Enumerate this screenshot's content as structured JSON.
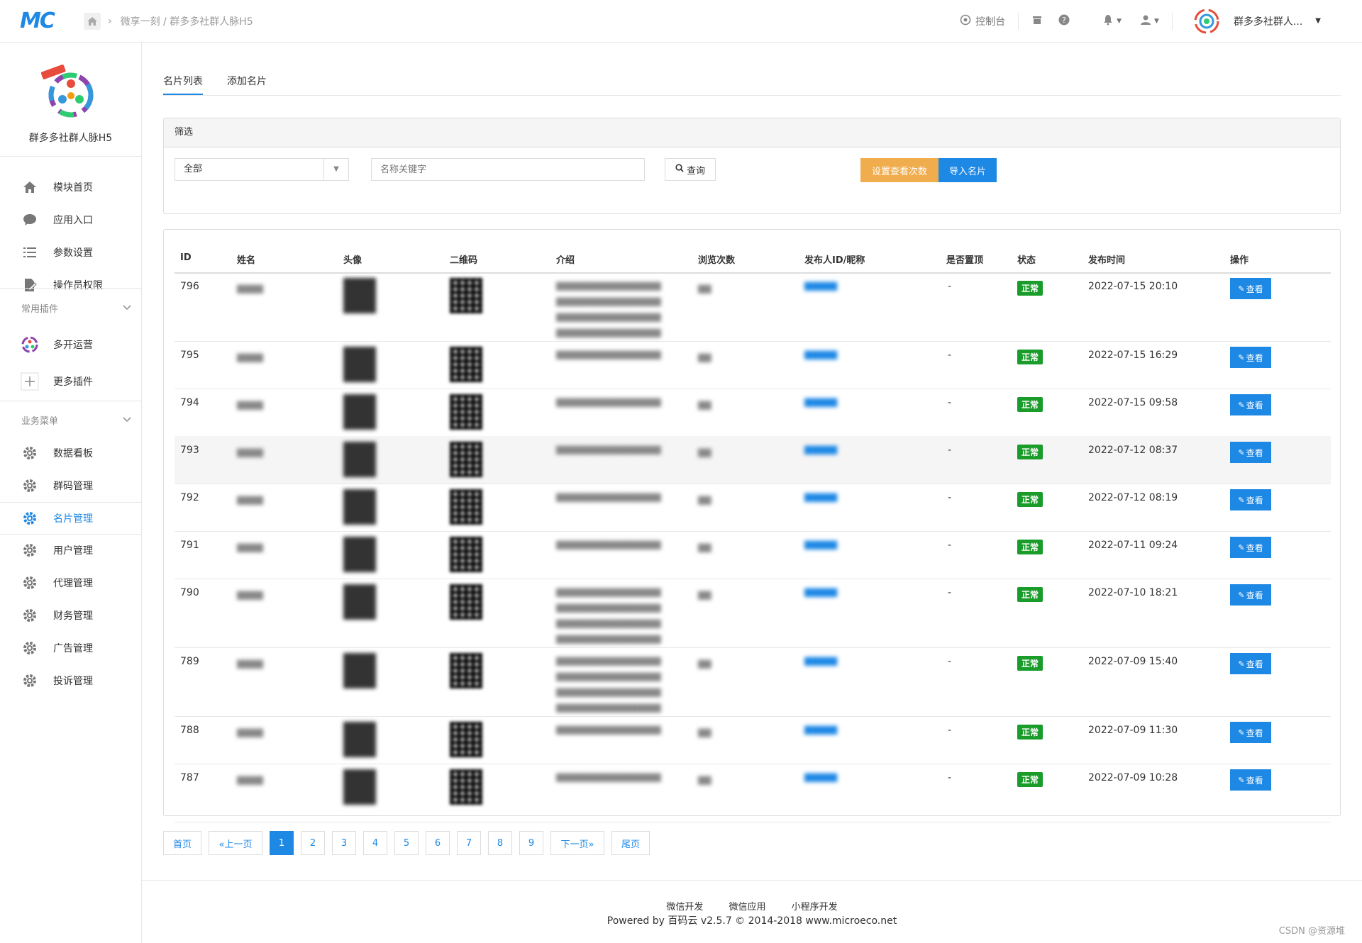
{
  "app": {
    "logo_text": "MC",
    "breadcrumb": "微享一刻 / 群多多社群人脉H5",
    "console": "控制台",
    "user_name": "群多多社群人...",
    "accent": "#1e88e5"
  },
  "sidebar": {
    "title": "群多多社群人脉H5",
    "items_top": [
      "模块首页",
      "应用入口",
      "参数设置",
      "操作员权限"
    ],
    "section_plugins": "常用插件",
    "plugins": [
      "多开运营",
      "更多插件"
    ],
    "section_business": "业务菜单",
    "business": [
      "数据看板",
      "群码管理",
      "名片管理",
      "用户管理",
      "代理管理",
      "财务管理",
      "广告管理",
      "投诉管理"
    ],
    "active": "名片管理"
  },
  "tabs": [
    "名片列表",
    "添加名片"
  ],
  "filter": {
    "title": "筛选",
    "select_value": "全部",
    "search_placeholder": "名称关键字",
    "query_label": "查询",
    "btn_views": "设置查看次数",
    "btn_import": "导入名片"
  },
  "table": {
    "headers": [
      "ID",
      "姓名",
      "头像",
      "二维码",
      "介绍",
      "浏览次数",
      "发布人ID/昵称",
      "是否置顶",
      "状态",
      "发布时间",
      "操作"
    ],
    "rows": [
      {
        "id": "796",
        "top": "-",
        "status": "正常",
        "time": "2022-07-15 20:10",
        "action": "查看"
      },
      {
        "id": "795",
        "top": "-",
        "status": "正常",
        "time": "2022-07-15 16:29",
        "action": "查看"
      },
      {
        "id": "794",
        "top": "-",
        "status": "正常",
        "time": "2022-07-15 09:58",
        "action": "查看"
      },
      {
        "id": "793",
        "top": "-",
        "status": "正常",
        "time": "2022-07-12 08:37",
        "action": "查看"
      },
      {
        "id": "792",
        "top": "-",
        "status": "正常",
        "time": "2022-07-12 08:19",
        "action": "查看"
      },
      {
        "id": "791",
        "top": "-",
        "status": "正常",
        "time": "2022-07-11 09:24",
        "action": "查看"
      },
      {
        "id": "790",
        "top": "-",
        "status": "正常",
        "time": "2022-07-10 18:21",
        "action": "查看"
      },
      {
        "id": "789",
        "top": "-",
        "status": "正常",
        "time": "2022-07-09 15:40",
        "action": "查看"
      },
      {
        "id": "788",
        "top": "-",
        "status": "正常",
        "time": "2022-07-09 11:30",
        "action": "查看"
      },
      {
        "id": "787",
        "top": "-",
        "status": "正常",
        "time": "2022-07-09 10:28",
        "action": "查看"
      }
    ]
  },
  "pager": {
    "first": "首页",
    "prev": "«上一页",
    "pages": [
      "1",
      "2",
      "3",
      "4",
      "5",
      "6",
      "7",
      "8",
      "9"
    ],
    "current": "1",
    "next": "下一页»",
    "last": "尾页"
  },
  "footer": {
    "links": [
      "微信开发",
      "微信应用",
      "小程序开发"
    ],
    "powered": "Powered by 百码云 v2.5.7 © 2014-2018 www.microeco.net",
    "watermark": "CSDN @资源堆"
  }
}
